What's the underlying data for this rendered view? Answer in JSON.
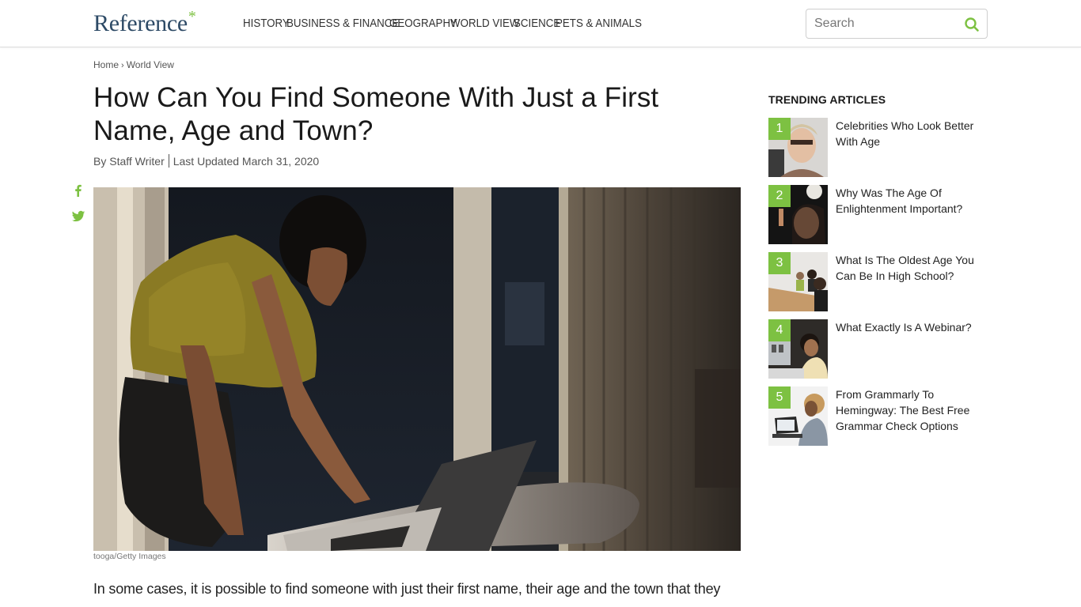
{
  "header": {
    "logo_text": "Reference",
    "logo_star": "*",
    "nav": [
      {
        "label": "HISTORY"
      },
      {
        "label": "BUSINESS & FINANCE"
      },
      {
        "label": "GEOGRAPHY"
      },
      {
        "label": "WORLD VIEW"
      },
      {
        "label": "SCIENCE"
      },
      {
        "label": "PETS & ANIMALS"
      }
    ],
    "search": {
      "placeholder": "Search",
      "value": ""
    }
  },
  "breadcrumb": {
    "items": [
      {
        "label": "Home"
      },
      {
        "label": "World View"
      }
    ],
    "separator": "›"
  },
  "article": {
    "title": "How Can You Find Someone With Just a First Name, Age and Town?",
    "author": "By Staff Writer",
    "updated": "Last Updated March 31, 2020",
    "image_caption": "tooga/Getty Images",
    "image_alt": "Woman leaning over a laptop by a window",
    "body_first_line": "In some cases, it is possible to find someone with just their first name, their age and the town that they"
  },
  "social": [
    {
      "name": "facebook",
      "icon": "facebook-icon"
    },
    {
      "name": "twitter",
      "icon": "twitter-icon"
    }
  ],
  "sidebar": {
    "title": "TRENDING ARTICLES",
    "items": [
      {
        "rank": "1",
        "label": "Celebrities Who Look Better With Age"
      },
      {
        "rank": "2",
        "label": "Why Was The Age Of Enlightenment Important?"
      },
      {
        "rank": "3",
        "label": "What Is The Oldest Age You Can Be In High School?"
      },
      {
        "rank": "4",
        "label": "What Exactly Is A Webinar?"
      },
      {
        "rank": "5",
        "label": "From Grammarly To Hemingway: The Best Free Grammar Check Options"
      }
    ]
  },
  "colors": {
    "accent": "#7dc142",
    "logo": "#2d4a66",
    "text": "#222222"
  }
}
